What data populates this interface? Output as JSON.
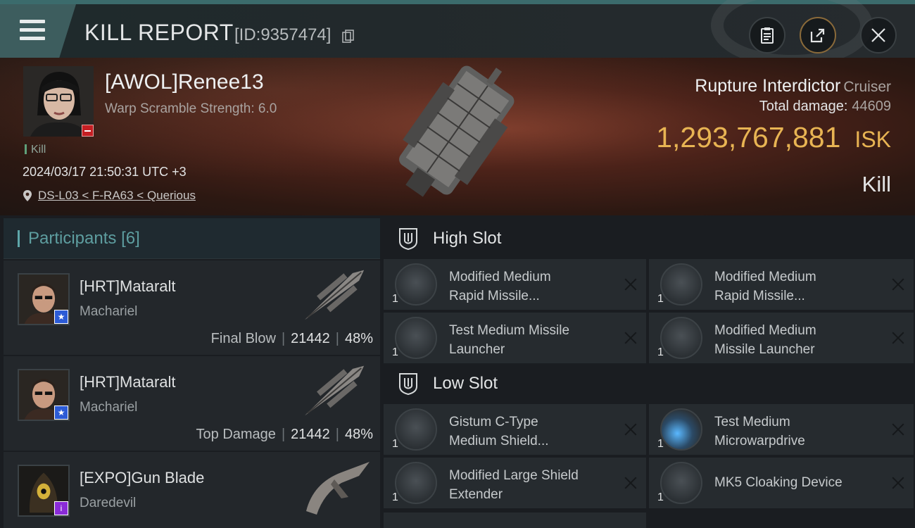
{
  "header": {
    "title": "KILL REPORT",
    "report_id": "[ID:9357474]",
    "icons": [
      "menu-icon",
      "copy-icon",
      "clipboard-icon",
      "share-icon",
      "close-icon"
    ]
  },
  "victim": {
    "name": "[AWOL]Renee13",
    "subtitle": "Warp Scramble Strength: 6.0",
    "tag": "Kill",
    "datetime": "2024/03/17 21:50:31 UTC +3",
    "location": "DS-L03 < F-RA63 < Querious",
    "ship_name": "Rupture Interdictor",
    "ship_class": "Cruiser",
    "total_damage_label": "Total damage:",
    "total_damage": "44609",
    "isk_value": "1,293,767,881",
    "isk_unit": "ISK",
    "result": "Kill"
  },
  "participants": {
    "label": "Participants",
    "count": "[6]",
    "rows": [
      {
        "name": "[HRT]Mataralt",
        "ship": "Machariel",
        "role": "Final Blow",
        "damage": "21442",
        "percent": "48%",
        "badge_color": "#2c5bd6",
        "badge_glyph": "★"
      },
      {
        "name": "[HRT]Mataralt",
        "ship": "Machariel",
        "role": "Top Damage",
        "damage": "21442",
        "percent": "48%",
        "badge_color": "#2c5bd6",
        "badge_glyph": "★"
      },
      {
        "name": "[EXPO]Gun Blade",
        "ship": "Daredevil",
        "role": "",
        "damage": "",
        "percent": "",
        "badge_color": "#8a2bd8",
        "badge_glyph": "i"
      }
    ]
  },
  "slots": {
    "high": {
      "label": "High Slot",
      "modules": [
        {
          "qty": "1",
          "name_line1": "Modified Medium",
          "name_line2": "Rapid Missile..."
        },
        {
          "qty": "1",
          "name_line1": "Modified Medium",
          "name_line2": "Rapid Missile..."
        },
        {
          "qty": "1",
          "name_line1": "Test Medium Missile",
          "name_line2": "Launcher"
        },
        {
          "qty": "1",
          "name_line1": "Modified Medium",
          "name_line2": "Missile Launcher"
        }
      ]
    },
    "low": {
      "label": "Low Slot",
      "modules": [
        {
          "qty": "1",
          "name_line1": "Gistum C-Type",
          "name_line2": "Medium Shield..."
        },
        {
          "qty": "1",
          "name_line1": "Test Medium",
          "name_line2": "Microwarpdrive"
        },
        {
          "qty": "1",
          "name_line1": "Modified Large Shield",
          "name_line2": "Extender"
        },
        {
          "qty": "1",
          "name_line1": "MK5 Cloaking Device",
          "name_line2": ""
        }
      ]
    }
  },
  "colors": {
    "accent_teal": "#5e9ea0",
    "isk_gold": "#e8b453",
    "victim_badge": "#c51f23"
  }
}
